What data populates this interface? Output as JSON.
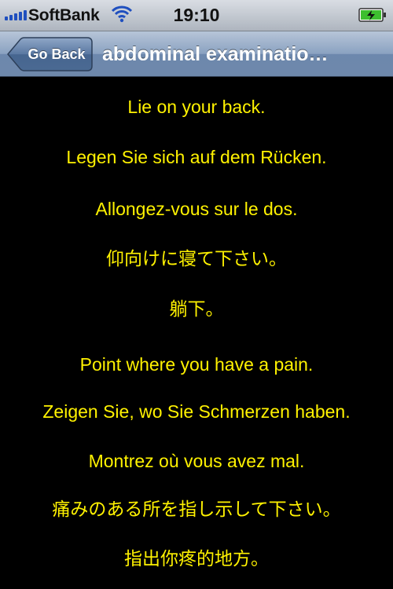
{
  "status_bar": {
    "carrier": "SoftBank",
    "time": "19:10",
    "signal_icon": "signal-bars-icon",
    "wifi_icon": "wifi-icon",
    "battery_icon": "battery-charging-icon",
    "accent_color": "#1f4fbf"
  },
  "nav_bar": {
    "back_label": "Go Back",
    "title": "abdominal examinatio…"
  },
  "phrases": [
    "Lie on your back.",
    "Legen Sie sich auf dem Rücken.",
    "Allongez-vous sur le dos.",
    "仰向けに寝て下さい。",
    "躺下。",
    "Point where you have a pain.",
    "Zeigen Sie, wo Sie Schmerzen haben.",
    "Montrez où vous avez mal.",
    "痛みのある所を指し示して下さい。",
    "指出你疼的地方。"
  ],
  "colors": {
    "text": "#fff200",
    "background": "#000000"
  }
}
